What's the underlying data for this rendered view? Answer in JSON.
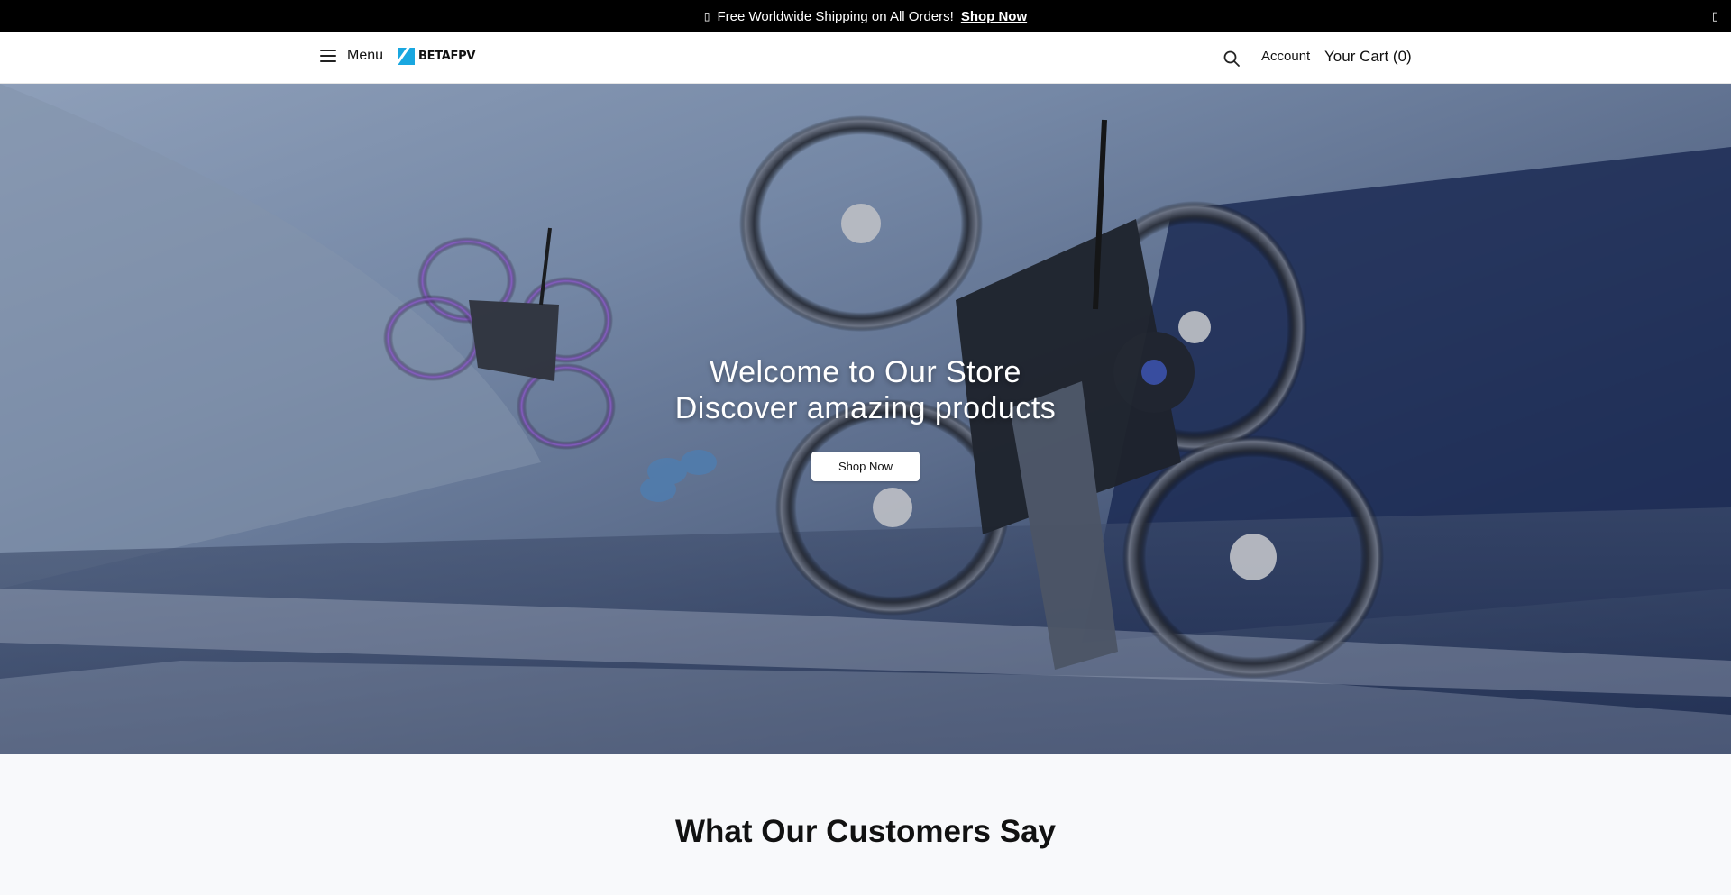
{
  "announcement": {
    "icon": "truck-icon",
    "text": "Free Worldwide Shipping on All Orders!",
    "link": "Shop Now",
    "close_icon": "close-icon"
  },
  "header": {
    "menu_label": "Menu",
    "logo_text": "BETAFPV",
    "account_label": "Account",
    "cart_label": "Your Cart (0)"
  },
  "hero": {
    "title_line1": "Welcome to Our Store",
    "title_line2": "Discover amazing products",
    "button_label": "Shop Now"
  },
  "testimonials": {
    "title": "What Our Customers Say"
  },
  "colors": {
    "announcement_bg": "#000000",
    "logo_accent": "#19a7e0",
    "hero_dark": "#22325a"
  }
}
